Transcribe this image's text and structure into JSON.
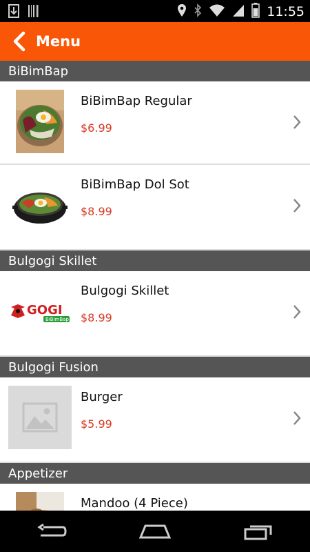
{
  "status_bar": {
    "time": "11:55",
    "left_icons": [
      "download-icon",
      "barcode-icon"
    ],
    "right_icons": [
      "location-icon",
      "bluetooth-icon",
      "wifi-icon",
      "signal-icon",
      "battery-icon"
    ]
  },
  "app_bar": {
    "title": "Menu",
    "background": "#fa5607"
  },
  "menu": {
    "sections": [
      {
        "title": "BiBimBap",
        "items": [
          {
            "name": "BiBimBap Regular",
            "price": "$6.99"
          },
          {
            "name": "BiBimBap Dol Sot",
            "price": "$8.99"
          }
        ]
      },
      {
        "title": "Bulgogi Skillet",
        "items": [
          {
            "name": "Bulgogi Skillet",
            "price": "$8.99",
            "logo": {
              "word": "GOGI",
              "sub": "BiBimBap"
            }
          }
        ]
      },
      {
        "title": "Bulgogi Fusion",
        "items": [
          {
            "name": "Burger",
            "price": "$5.99"
          }
        ]
      },
      {
        "title": "Appetizer",
        "items": [
          {
            "name": "Mandoo (4 Piece)",
            "price": ""
          }
        ]
      }
    ]
  },
  "nav_bar": {
    "buttons": [
      "back-icon",
      "home-icon",
      "recent-apps-icon"
    ]
  },
  "colors": {
    "accent": "#fa5607",
    "price": "#d83a23",
    "section_header": "#555555"
  }
}
